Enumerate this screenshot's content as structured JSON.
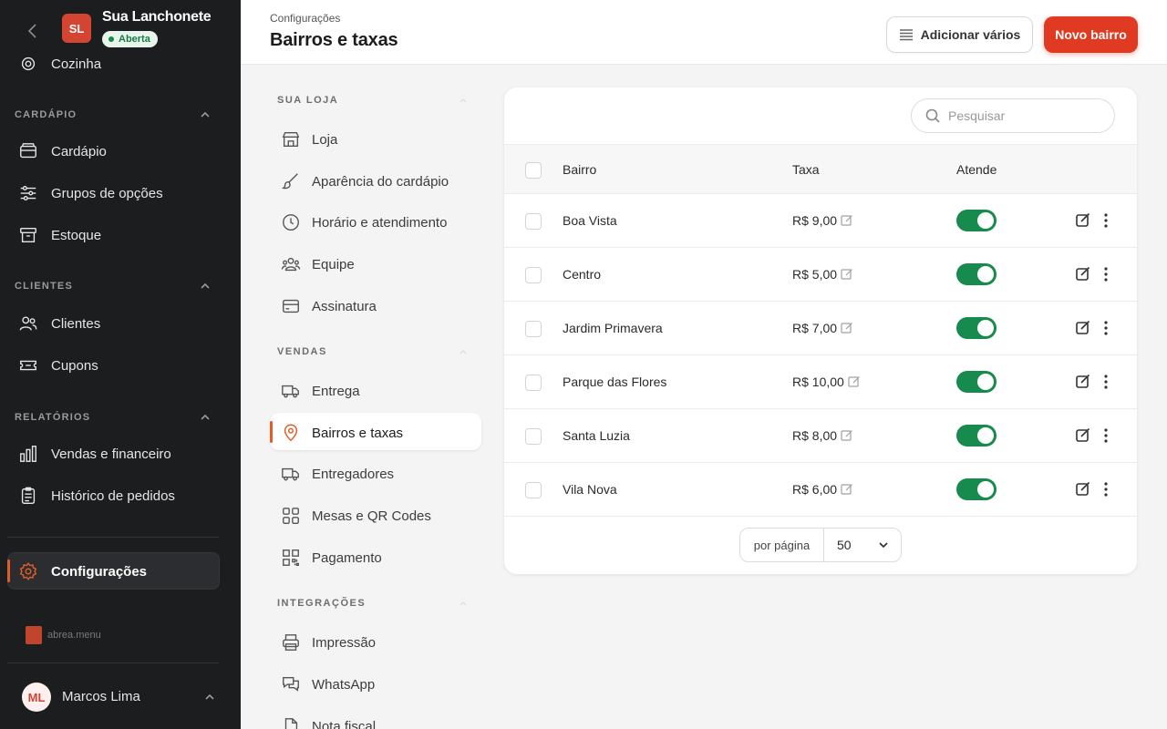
{
  "sidebar": {
    "store": {
      "initials": "SL",
      "name": "Sua Lanchonete",
      "status": "Aberta"
    },
    "cut_item": "Cozinha",
    "sections": [
      {
        "title": "CARDÁPIO",
        "items": [
          "Cardápio",
          "Grupos de opções",
          "Estoque"
        ]
      },
      {
        "title": "CLIENTES",
        "items": [
          "Clientes",
          "Cupons"
        ]
      },
      {
        "title": "RELATÓRIOS",
        "items": [
          "Vendas e financeiro",
          "Histórico de pedidos"
        ]
      }
    ],
    "active_item": "Configurações",
    "brand": "abrea.menu",
    "user": {
      "initials": "ML",
      "name": "Marcos Lima"
    }
  },
  "header": {
    "breadcrumb": "Configurações",
    "title": "Bairros e taxas",
    "add_many_label": "Adicionar vários",
    "new_label": "Novo bairro"
  },
  "settings_nav": {
    "sections": [
      {
        "title": "SUA LOJA",
        "items": [
          "Loja",
          "Aparência do cardápio",
          "Horário e atendimento",
          "Equipe",
          "Assinatura"
        ]
      },
      {
        "title": "VENDAS",
        "items": [
          "Entrega",
          "Bairros e taxas",
          "Entregadores",
          "Mesas e QR Codes",
          "Pagamento"
        ]
      },
      {
        "title": "INTEGRAÇÕES",
        "items": [
          "Impressão",
          "WhatsApp",
          "Nota fiscal"
        ]
      }
    ]
  },
  "table": {
    "search_placeholder": "Pesquisar",
    "columns": {
      "neighborhood": "Bairro",
      "fee": "Taxa",
      "serves": "Atende"
    },
    "rows": [
      {
        "name": "Boa Vista",
        "fee": "R$ 9,00",
        "serves": true
      },
      {
        "name": "Centro",
        "fee": "R$ 5,00",
        "serves": true
      },
      {
        "name": "Jardim Primavera",
        "fee": "R$ 7,00",
        "serves": true
      },
      {
        "name": "Parque das Flores",
        "fee": "R$ 10,00",
        "serves": true
      },
      {
        "name": "Santa Luzia",
        "fee": "R$ 8,00",
        "serves": true
      },
      {
        "name": "Vila Nova",
        "fee": "R$ 6,00",
        "serves": true
      }
    ],
    "pagination": {
      "label": "por página",
      "value": "50"
    }
  },
  "colors": {
    "accent": "#e03a22",
    "toggle_on": "#178a4e",
    "sidebar_bg": "#1c1d1f",
    "active_marker": "#e05d2a"
  }
}
